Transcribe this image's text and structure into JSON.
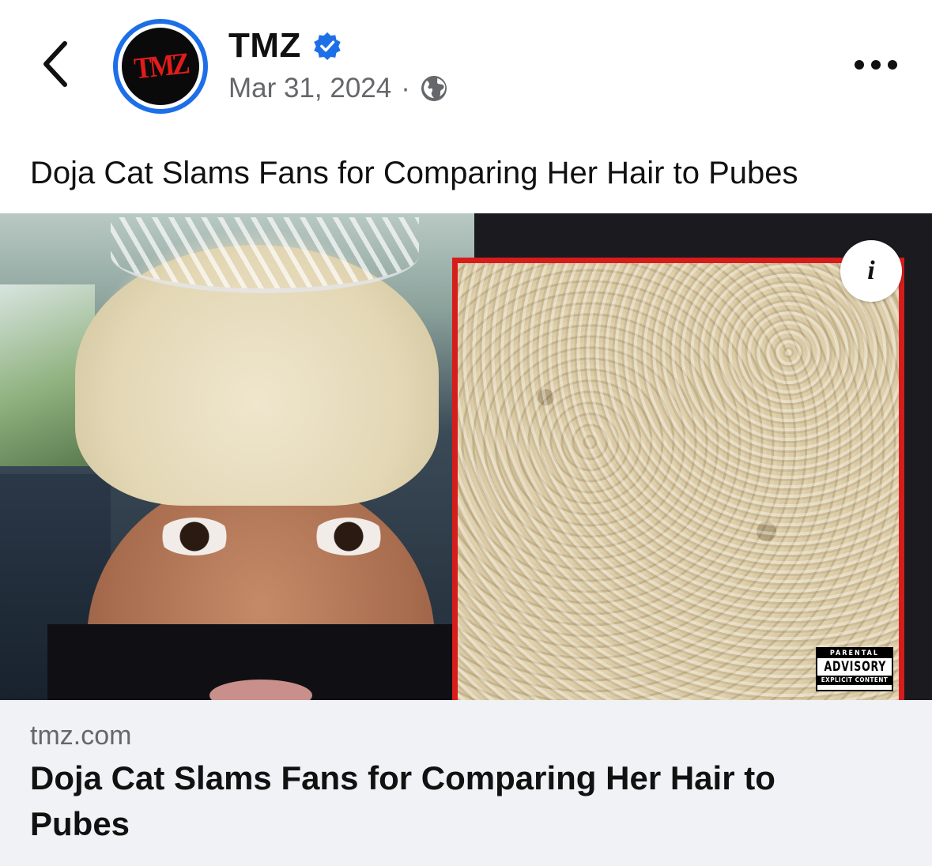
{
  "header": {
    "page_name": "TMZ",
    "logo_text": "TMZ",
    "date": "Mar 31, 2024",
    "separator": "·",
    "verified": true,
    "privacy": "public"
  },
  "post": {
    "caption": "Doja Cat Slams Fans for Comparing Her Hair to Pubes"
  },
  "media": {
    "advisory_top": "PARENTAL",
    "advisory_mid": "ADVISORY",
    "advisory_bottom": "EXPLICIT CONTENT",
    "info_glyph": "i"
  },
  "link_preview": {
    "domain": "tmz.com",
    "title": "Doja Cat Slams Fans for Comparing Her Hair to Pubes"
  },
  "colors": {
    "verified_blue": "#1d6fe8",
    "brand_red": "#e31b1b",
    "meta_gray": "#65676b",
    "preview_bg": "#f0f2f5"
  }
}
